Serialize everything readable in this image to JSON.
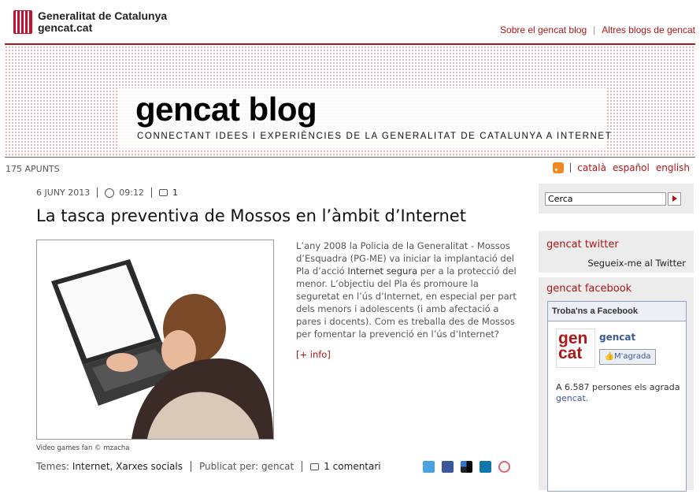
{
  "header": {
    "logo_line1": "Generalitat de Catalunya",
    "logo_line2": "gencat.cat",
    "links": [
      "Sobre el gencat blog",
      "Altres blogs de gencat"
    ],
    "site_title": "gencat blog",
    "tagline": "CONNECTANT IDEES I EXPERIÈNCIES DE LA GENERALITAT DE CATALUNYA A INTERNET"
  },
  "subbar": {
    "count": "175 APUNTS",
    "languages": [
      "català",
      "español",
      "english"
    ]
  },
  "post": {
    "date": "6 JUNY 2013",
    "time": "09:12",
    "comment_count": "1",
    "title": "La tasca preventiva de Mossos en l’àmbit d’Internet",
    "caption": "Video games fan © mzacha",
    "body_pre": "L’any 2008 la Policia de la Generalitat - Mossos d’Esquadra (PG-ME) va iniciar la implantació del Pla d’acció ",
    "body_bold": "Internet segura",
    "body_post": " per a la protecció del menor. L’objectiu del Pla és promoure la seguretat en l’ús d’Internet, en especial per part dels menors i adolescents (i amb afectació a pares i docents). Com es treballa des de Mossos per fomentar la prevenció en l’ús d’Internet?",
    "more": "[+ info]",
    "topics_label": "Temes:",
    "topics": "Internet, Xarxes socials",
    "author_label": "Publicat per:",
    "author": "gencat",
    "comments_link": "1 comentari"
  },
  "share_icons": [
    "twitter-icon",
    "facebook-icon",
    "delicious-icon",
    "linkedin-icon",
    "meneame-icon"
  ],
  "sidebar": {
    "search_value": "Cerca",
    "twitter_title": "gencat twitter",
    "twitter_link": "Segueix-me al Twitter",
    "facebook_title": "gencat facebook",
    "fb_header": "Troba'ns a Facebook",
    "fb_logo_line1": "gen",
    "fb_logo_line2": "cat",
    "fb_name": "gencat",
    "fb_like": "M'agrada",
    "fb_count": "A 6.587 persones els agrada",
    "fb_page": "gencat."
  },
  "colors": {
    "accent": "#b01616",
    "facebook": "#3b5998"
  }
}
